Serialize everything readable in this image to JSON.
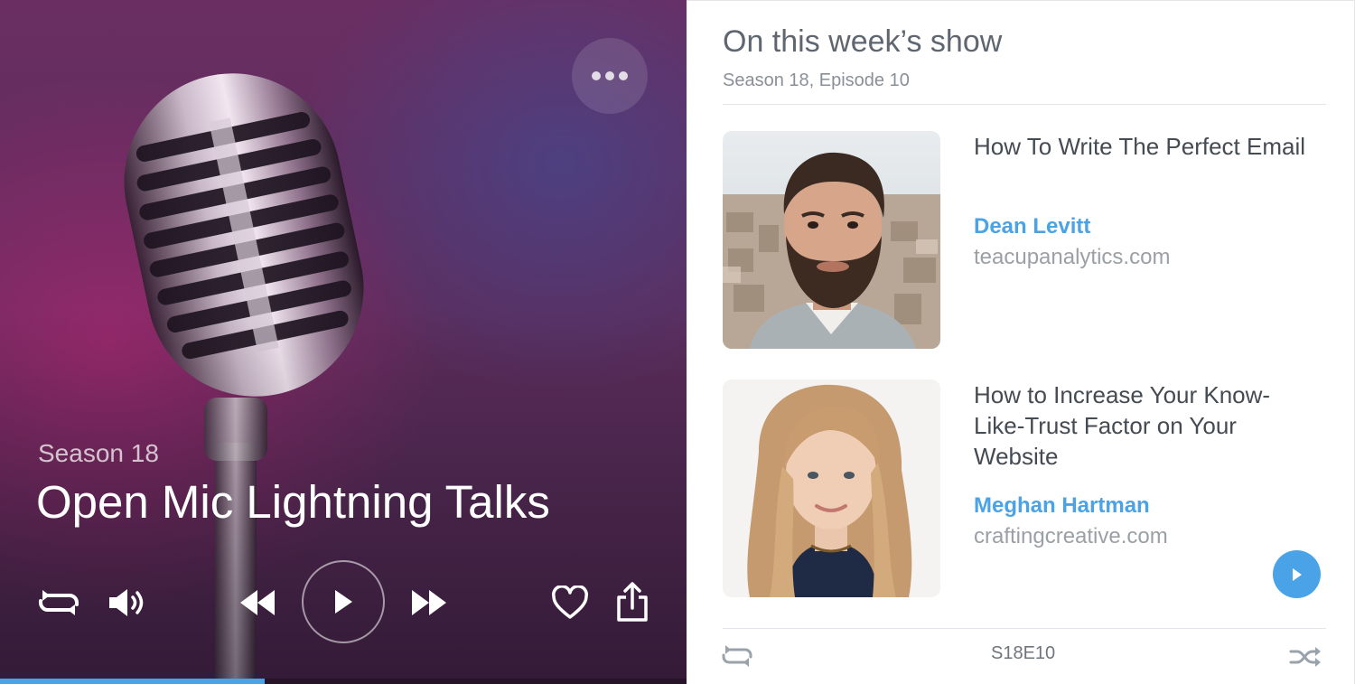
{
  "player": {
    "season": "Season 18",
    "title": "Open Mic Lightning Talks",
    "progress_fraction": 0.385,
    "controls": {
      "more": "more-options-icon",
      "repeat": "repeat-icon",
      "volume": "volume-icon",
      "rewind": "rewind-icon",
      "play": "play-icon",
      "fast_forward": "fast-forward-icon",
      "like": "heart-icon",
      "share": "share-icon"
    },
    "accent_color": "#4aa3e6"
  },
  "episode": {
    "heading": "On this week’s show",
    "subheading": "Season 18, Episode 10",
    "guests": [
      {
        "talk": "How To Write The Perfect Email",
        "name": "Dean Levitt",
        "site": "teacupanalytics.com"
      },
      {
        "talk": "How to Increase Your Know-Like-Trust Factor on Your Website",
        "name": "Meghan Hartman",
        "site": "craftingcreative.com"
      }
    ],
    "footer_code": "S18E10",
    "footer_icons": [
      "repeat-icon",
      "shuffle-icon"
    ],
    "play_button": "play-icon"
  }
}
